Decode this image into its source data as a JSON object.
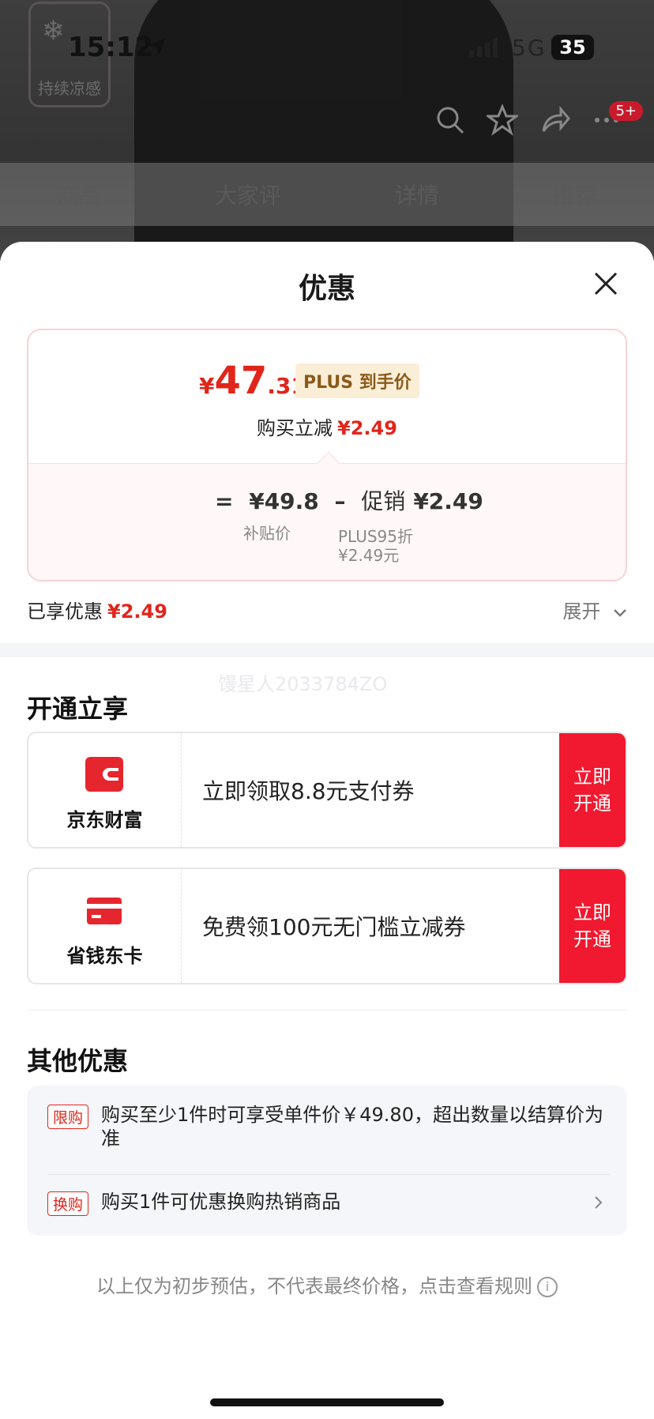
{
  "status_bar": {
    "time": "15:12",
    "network": "5G",
    "battery": "35"
  },
  "background": {
    "badge_label": "持续凉感",
    "cart_badge": "5+",
    "tabs": [
      "商品",
      "大家评",
      "详情",
      "推荐"
    ]
  },
  "sheet": {
    "title": "优惠",
    "price": {
      "currency": "¥",
      "integer": "47",
      "decimal": ".31",
      "tag": "PLUS 到手价"
    },
    "reduce": {
      "label": "购买立减",
      "value": "¥2.49"
    },
    "formula": {
      "eq": "=",
      "base": "¥49.8",
      "minus": "–",
      "promo_label": "促销",
      "promo_value": "¥2.49"
    },
    "sub_base": "补贴价",
    "sub_promo_1": "PLUS95折",
    "sub_promo_2": "¥2.49元",
    "enjoyed": {
      "label": "已享优惠",
      "value": "¥2.49"
    },
    "expand_label": "展开",
    "watermark": "馒星人2033784ZO"
  },
  "open_section": {
    "title": "开通立享",
    "cards": [
      {
        "name": "京东财富",
        "text": "立即领取8.8元支付券",
        "button": "立即开通"
      },
      {
        "name": "省钱东卡",
        "text": "免费领100元无门槛立减券",
        "button": "立即开通"
      }
    ]
  },
  "other_section": {
    "title": "其他优惠",
    "rules": [
      {
        "tag": "限购",
        "text": "购买至少1件时可享受单件价￥49.80，超出数量以结算价为准"
      },
      {
        "tag": "换购",
        "text": "购买1件可优惠换购热销商品"
      }
    ]
  },
  "footer": {
    "note": "以上仅为初步预估，不代表最终价格，点击查看规则"
  },
  "colors": {
    "accent_red": "#e1251b",
    "button_red": "#f1192f",
    "plus_tag_bg": "#fbeed6"
  },
  "icons": [
    "location-arrow-icon",
    "search-icon",
    "star-icon",
    "share-icon",
    "more-icon",
    "close-icon",
    "chevron-down-icon",
    "wallet-icon",
    "card-icon",
    "chevron-right-icon",
    "info-icon"
  ]
}
